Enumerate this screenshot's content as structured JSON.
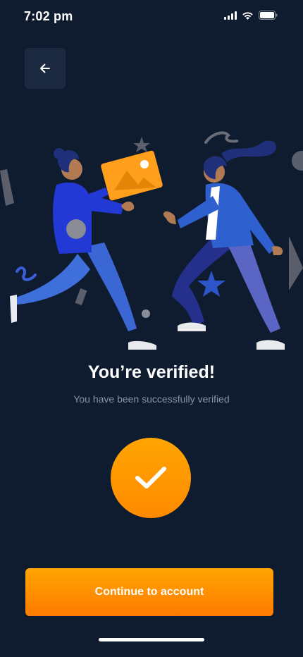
{
  "status_bar": {
    "time": "7:02 pm",
    "icons": [
      "cellular-signal-icon",
      "wifi-icon",
      "battery-icon"
    ]
  },
  "header": {
    "back_icon": "arrow-left-icon"
  },
  "content": {
    "title": "You’re verified!",
    "subtitle": "You have been successfully verified",
    "badge_icon": "checkmark-icon"
  },
  "actions": {
    "continue_label": "Continue to account"
  },
  "colors": {
    "background": "#0f1c2f",
    "accent": "#ff9500",
    "card": "#1b2a40",
    "subtitle": "#8a93a3"
  }
}
